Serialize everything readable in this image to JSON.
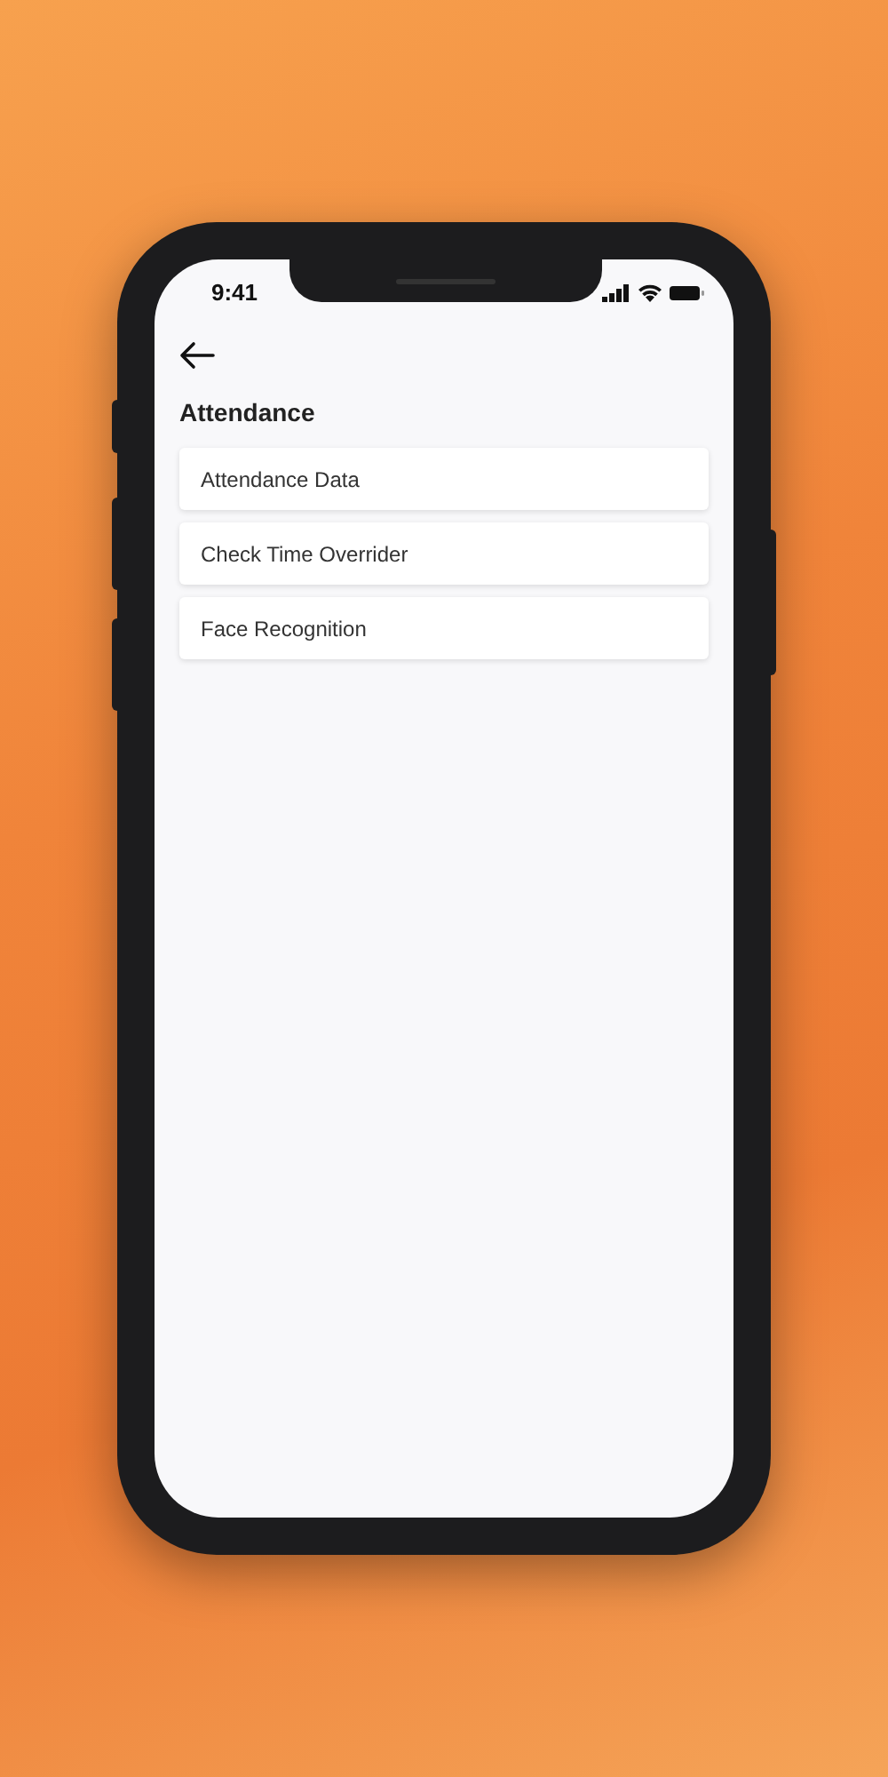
{
  "status_bar": {
    "time": "9:41"
  },
  "page": {
    "title": "Attendance"
  },
  "menu_items": [
    {
      "label": "Attendance Data"
    },
    {
      "label": "Check Time Overrider"
    },
    {
      "label": "Face Recognition"
    }
  ]
}
